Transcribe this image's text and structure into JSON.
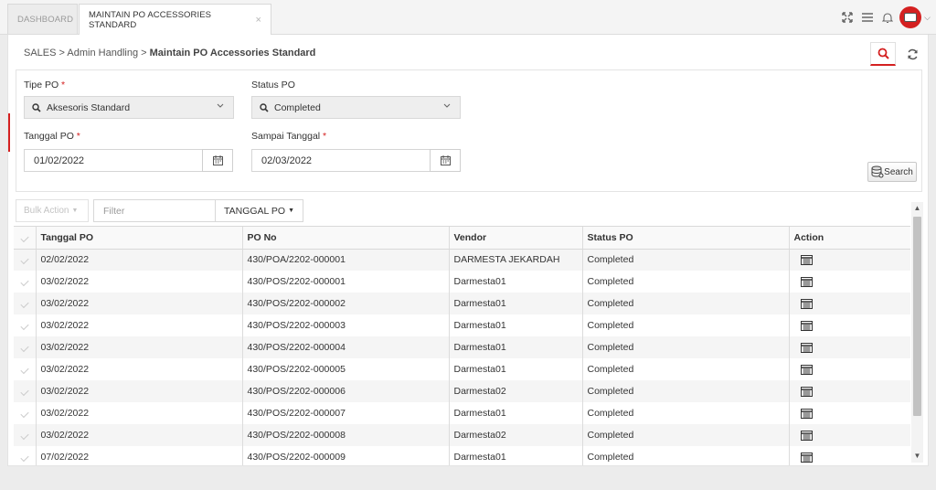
{
  "tabs": [
    {
      "label": "DASHBOARD"
    },
    {
      "label": "MAINTAIN PO ACCESSORIES STANDARD",
      "close": "×"
    }
  ],
  "breadcrumb": {
    "part1": "SALES",
    "sep": ">",
    "part2": "Admin Handling",
    "current": "Maintain PO Accessories Standard"
  },
  "form": {
    "tipe_po": {
      "label": "Tipe PO",
      "required": "*",
      "value": "Aksesoris Standard"
    },
    "status_po": {
      "label": "Status PO",
      "value": "Completed"
    },
    "tanggal_po": {
      "label": "Tanggal PO",
      "required": "*",
      "value": "01/02/2022"
    },
    "sampai_tanggal": {
      "label": "Sampai Tanggal",
      "required": "*",
      "value": "02/03/2022"
    },
    "search_label": "Search"
  },
  "toolbar": {
    "bulk_action": "Bulk Action",
    "filter_placeholder": "Filter",
    "column_selector": "TANGGAL PO"
  },
  "table": {
    "headers": [
      "Tanggal PO",
      "PO No",
      "Vendor",
      "Status PO",
      "Action"
    ],
    "rows": [
      {
        "tanggal": "02/02/2022",
        "po_no": "430/POA/2202-000001",
        "vendor": "DARMESTA JEKARDAH",
        "status": "Completed"
      },
      {
        "tanggal": "03/02/2022",
        "po_no": "430/POS/2202-000001",
        "vendor": "Darmesta01",
        "status": "Completed"
      },
      {
        "tanggal": "03/02/2022",
        "po_no": "430/POS/2202-000002",
        "vendor": "Darmesta01",
        "status": "Completed"
      },
      {
        "tanggal": "03/02/2022",
        "po_no": "430/POS/2202-000003",
        "vendor": "Darmesta01",
        "status": "Completed"
      },
      {
        "tanggal": "03/02/2022",
        "po_no": "430/POS/2202-000004",
        "vendor": "Darmesta01",
        "status": "Completed"
      },
      {
        "tanggal": "03/02/2022",
        "po_no": "430/POS/2202-000005",
        "vendor": "Darmesta01",
        "status": "Completed"
      },
      {
        "tanggal": "03/02/2022",
        "po_no": "430/POS/2202-000006",
        "vendor": "Darmesta02",
        "status": "Completed"
      },
      {
        "tanggal": "03/02/2022",
        "po_no": "430/POS/2202-000007",
        "vendor": "Darmesta01",
        "status": "Completed"
      },
      {
        "tanggal": "03/02/2022",
        "po_no": "430/POS/2202-000008",
        "vendor": "Darmesta02",
        "status": "Completed"
      },
      {
        "tanggal": "07/02/2022",
        "po_no": "430/POS/2202-000009",
        "vendor": "Darmesta01",
        "status": "Completed"
      }
    ]
  },
  "colors": {
    "accent": "#d42020",
    "row_alt": "#f5f5f5",
    "header_bg": "#f9f9f9"
  },
  "icons": [
    "fullscreen-icon",
    "menu-icon",
    "bell-icon",
    "user-avatar-icon",
    "search-icon",
    "refresh-icon",
    "calendar-icon",
    "database-search-icon",
    "detail-list-icon"
  ]
}
